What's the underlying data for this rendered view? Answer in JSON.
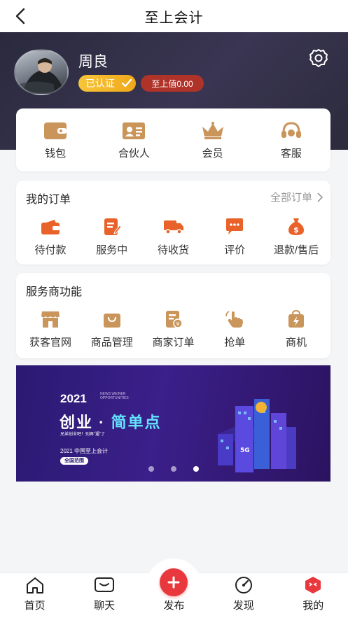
{
  "nav": {
    "title": "至上会计",
    "back_icon": "chevron-left-icon"
  },
  "profile": {
    "name": "周良",
    "auth_badge": "已认证",
    "value_badge": "至上值0.00",
    "settings_icon": "gear-icon"
  },
  "quick": [
    {
      "label": "钱包",
      "icon": "wallet-icon"
    },
    {
      "label": "合伙人",
      "icon": "id-card-icon"
    },
    {
      "label": "会员",
      "icon": "crown-icon"
    },
    {
      "label": "客服",
      "icon": "headset-icon"
    }
  ],
  "orders": {
    "title": "我的订单",
    "more": "全部订单",
    "items": [
      {
        "label": "待付款",
        "icon": "wallet-icon"
      },
      {
        "label": "服务中",
        "icon": "edit-document-icon"
      },
      {
        "label": "待收货",
        "icon": "truck-icon"
      },
      {
        "label": "评价",
        "icon": "comment-icon"
      },
      {
        "label": "退款/售后",
        "icon": "money-bag-icon"
      }
    ]
  },
  "services": {
    "title": "服务商功能",
    "items": [
      {
        "label": "获客官网",
        "icon": "storefront-icon"
      },
      {
        "label": "商品管理",
        "icon": "shopping-bag-icon"
      },
      {
        "label": "商家订单",
        "icon": "order-document-icon"
      },
      {
        "label": "抢单",
        "icon": "hand-tap-icon"
      },
      {
        "label": "商机",
        "icon": "lightning-bag-icon"
      }
    ]
  },
  "banner": {
    "year": "2021",
    "small_en": "NEWS WEINER OPPORTUNITIES",
    "headline_a": "创业",
    "headline_sep": "·",
    "headline_b": "简单点",
    "slogan": "兄弟创业吧！别再“遛”了",
    "sub": "2021 中国至上会计",
    "pill": "全国范围",
    "slide_count": 3,
    "active_slide": 3
  },
  "tabbar": [
    {
      "label": "首页",
      "icon": "home-icon"
    },
    {
      "label": "聊天",
      "icon": "chat-icon"
    },
    {
      "label": "发布",
      "icon": "plus-icon"
    },
    {
      "label": "发现",
      "icon": "compass-icon"
    },
    {
      "label": "我的",
      "icon": "profile-face-icon"
    }
  ],
  "colors": {
    "accent_red": "#e8383d",
    "icon_orange": "#e8622a",
    "icon_tan": "#c9955a",
    "hero_dark": "#2a2a3d",
    "auth_gold": "#f0a81a",
    "value_red": "#b0332a"
  }
}
